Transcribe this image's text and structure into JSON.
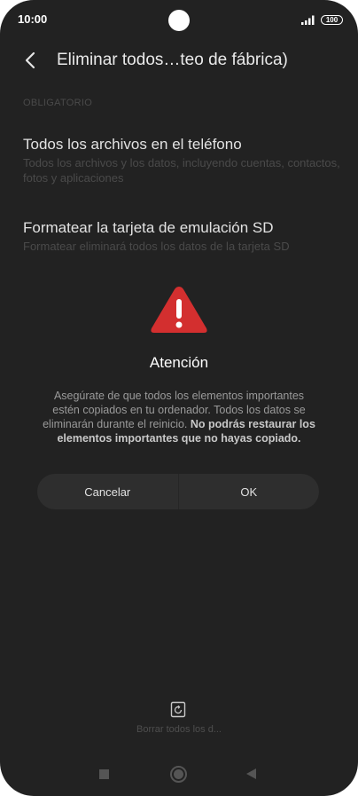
{
  "status_bar": {
    "time": "10:00",
    "battery": "100",
    "icons": [
      "signal-icon",
      "battery-icon"
    ]
  },
  "header": {
    "back_icon": "chevron-left-icon",
    "title": "Eliminar todos…teo de fábrica)"
  },
  "settings": {
    "section_label": "OBLIGATORIO",
    "options": [
      {
        "title": "Todos los archivos en el teléfono",
        "description": "Todos los archivos y los datos, incluyendo cuentas, contactos, fotos y aplicaciones"
      },
      {
        "title": "Formatear la tarjeta de emulación SD",
        "description": "Formatear eliminará todos los datos de la tarjeta SD"
      }
    ]
  },
  "dialog": {
    "icon": "warning-triangle-icon",
    "title": "Atención",
    "message": "Asegúrate de que todos los elementos importantes estén copiados en tu ordenador. Todos los datos se eliminarán durante el reinicio.",
    "message_bold": "No podrás restaurar los elementos importantes que no hayas copiado.",
    "cancel_label": "Cancelar",
    "ok_label": "OK"
  },
  "bottom_action": {
    "icon": "erase-phone-icon",
    "label": "Borrar todos los d..."
  },
  "nav_bar": {
    "icons": [
      "recents-square-icon",
      "home-circle-icon",
      "back-triangle-icon"
    ]
  },
  "colors": {
    "background": "#222222",
    "warning": "#d32f2f",
    "button_bg": "#2e2e2e",
    "dimmed_text": "#4a4a4a"
  }
}
